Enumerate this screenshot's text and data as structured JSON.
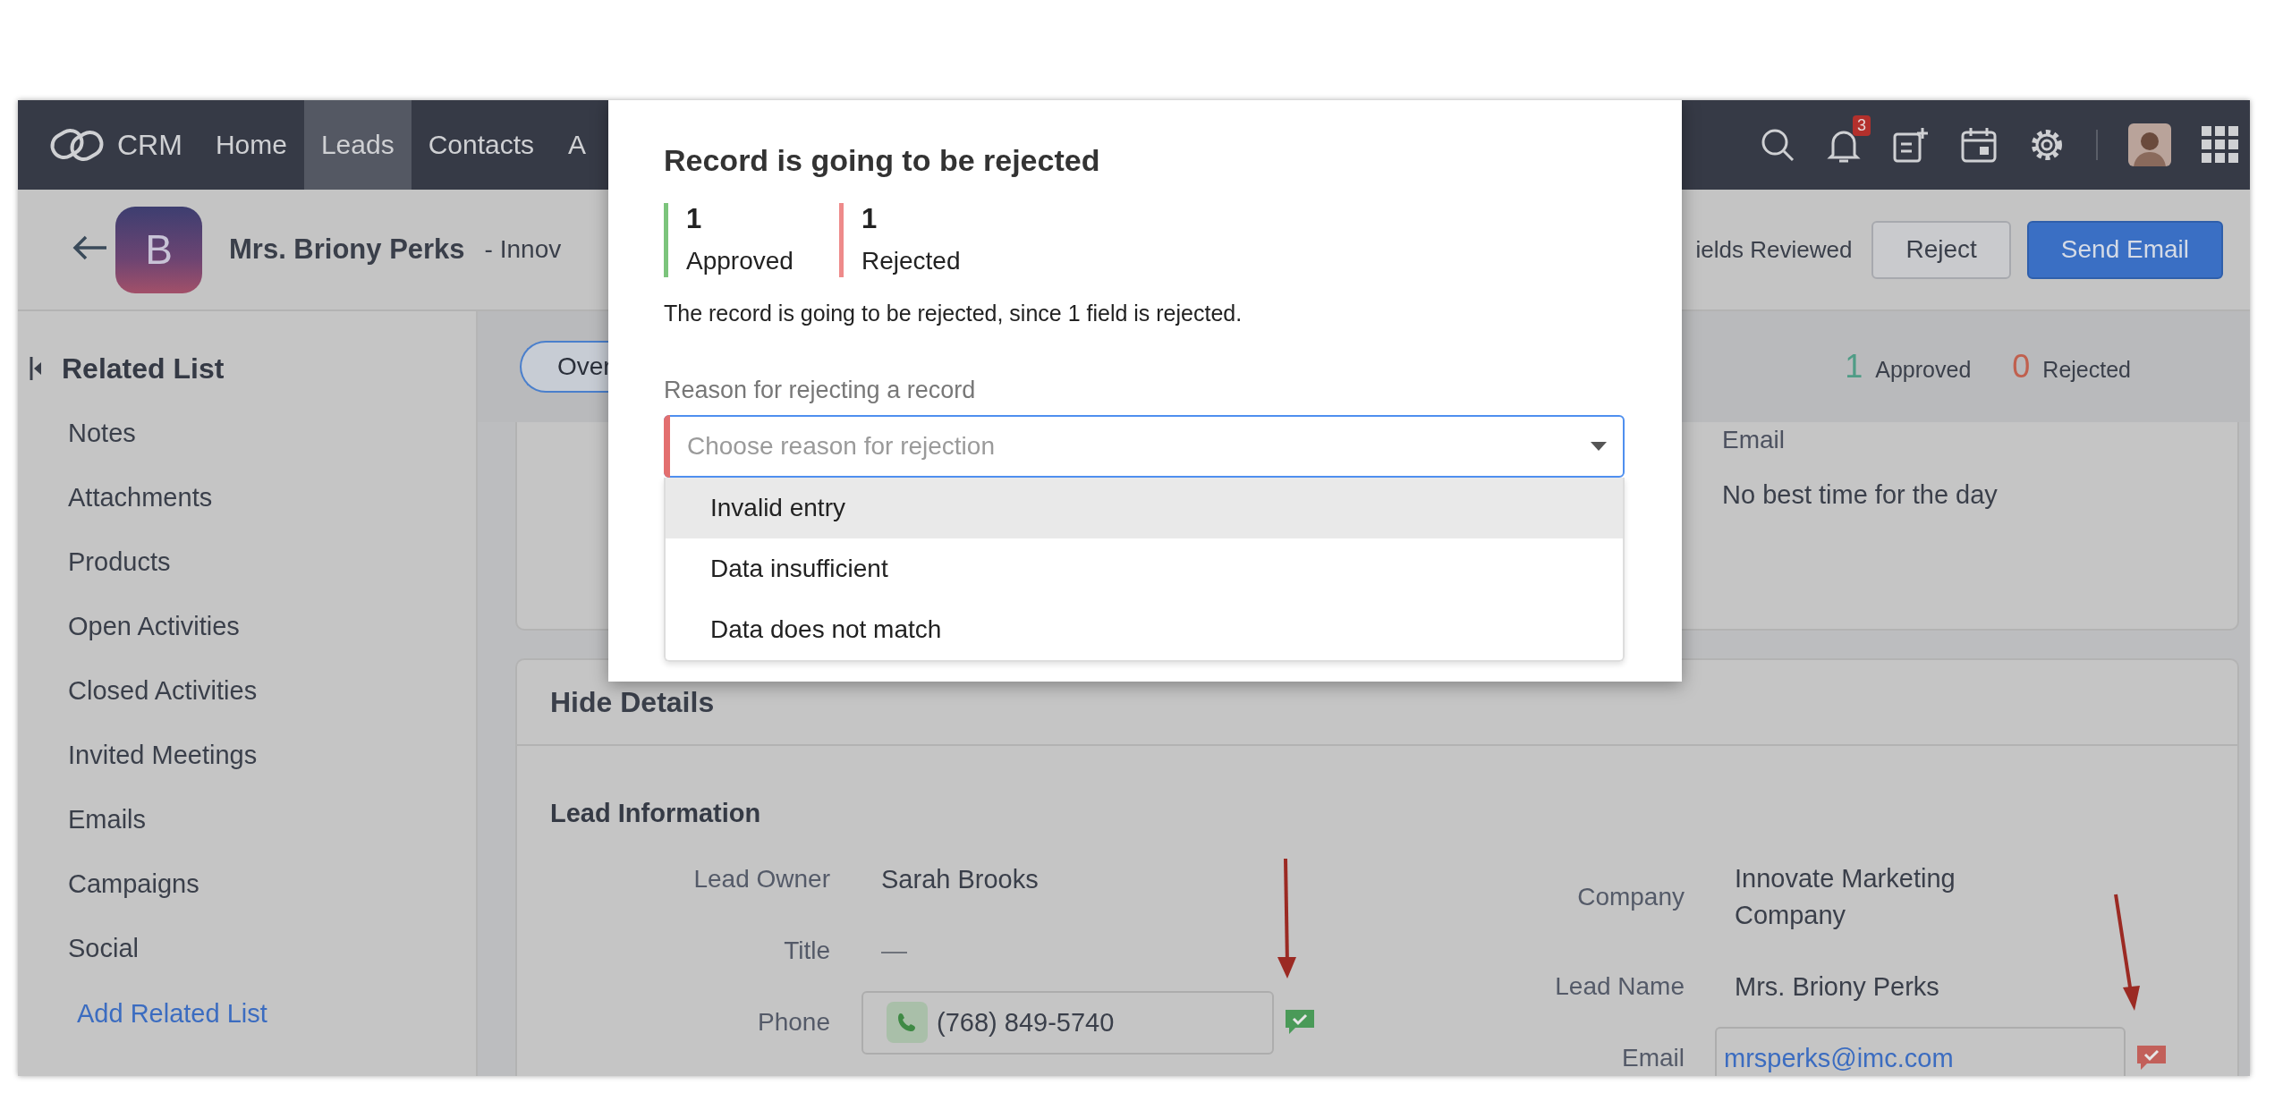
{
  "nav": {
    "logo": "CRM",
    "tabs": [
      {
        "label": "Home",
        "selected": false
      },
      {
        "label": "Leads",
        "selected": true
      },
      {
        "label": "Contacts",
        "selected": false
      },
      {
        "label": "A",
        "selected": false
      }
    ],
    "notification_count": "3"
  },
  "header": {
    "avatar_letter": "B",
    "name": "Mrs. Briony Perks",
    "subtitle": "- Innov",
    "review_status": "ields Reviewed",
    "buttons": [
      {
        "label": "Reject",
        "kind": "secondary"
      },
      {
        "label": "Send Email",
        "kind": "primary"
      }
    ]
  },
  "sidebar": {
    "title": "Related List",
    "items": [
      "Notes",
      "Attachments",
      "Products",
      "Open Activities",
      "Closed Activities",
      "Invited Meetings",
      "Emails",
      "Campaigns",
      "Social"
    ],
    "add_link": "Add Related List"
  },
  "tabs_bar": {
    "tabs": [
      {
        "label": "Over",
        "selected": true
      }
    ],
    "review_counts": [
      {
        "count": "1",
        "label": "Approved",
        "color": "#4f9c86"
      },
      {
        "count": "0",
        "label": "Rejected",
        "color": "#c0604e"
      }
    ]
  },
  "summary_card": {
    "fields": [
      {
        "label": "Email",
        "value": "No best time for the day"
      }
    ]
  },
  "details": {
    "toggle": "Hide Details",
    "section": "Lead Information",
    "left_fields": [
      {
        "label": "Lead Owner",
        "value": "Sarah Brooks",
        "kind": "text"
      },
      {
        "label": "Title",
        "value": "—",
        "kind": "empty"
      },
      {
        "label": "Phone",
        "value": "(768) 849-5740",
        "kind": "phone",
        "approved": true
      }
    ],
    "right_fields": [
      {
        "label": "Company",
        "value": "Innovate Marketing Company",
        "kind": "text"
      },
      {
        "label": "Lead Name",
        "value": "Mrs. Briony Perks",
        "kind": "text"
      },
      {
        "label": "Email",
        "value": "mrsperks@imc.com",
        "kind": "email",
        "approved": false
      }
    ]
  },
  "dialog": {
    "title": "Record is going to be rejected",
    "stats": [
      {
        "count": "1",
        "label": "Approved",
        "color": "#7cc47c"
      },
      {
        "count": "1",
        "label": "Rejected",
        "color": "#ee8a8a"
      }
    ],
    "message": "The record is going to be rejected, since 1 field is rejected.",
    "reason_label": "Reason for rejecting a record",
    "select": {
      "placeholder": "Choose reason for rejection",
      "required": true,
      "expanded": true
    },
    "options": [
      {
        "label": "Invalid entry",
        "selected": true
      },
      {
        "label": "Data insufficient",
        "selected": false
      },
      {
        "label": "Data does not match",
        "selected": false
      }
    ]
  }
}
